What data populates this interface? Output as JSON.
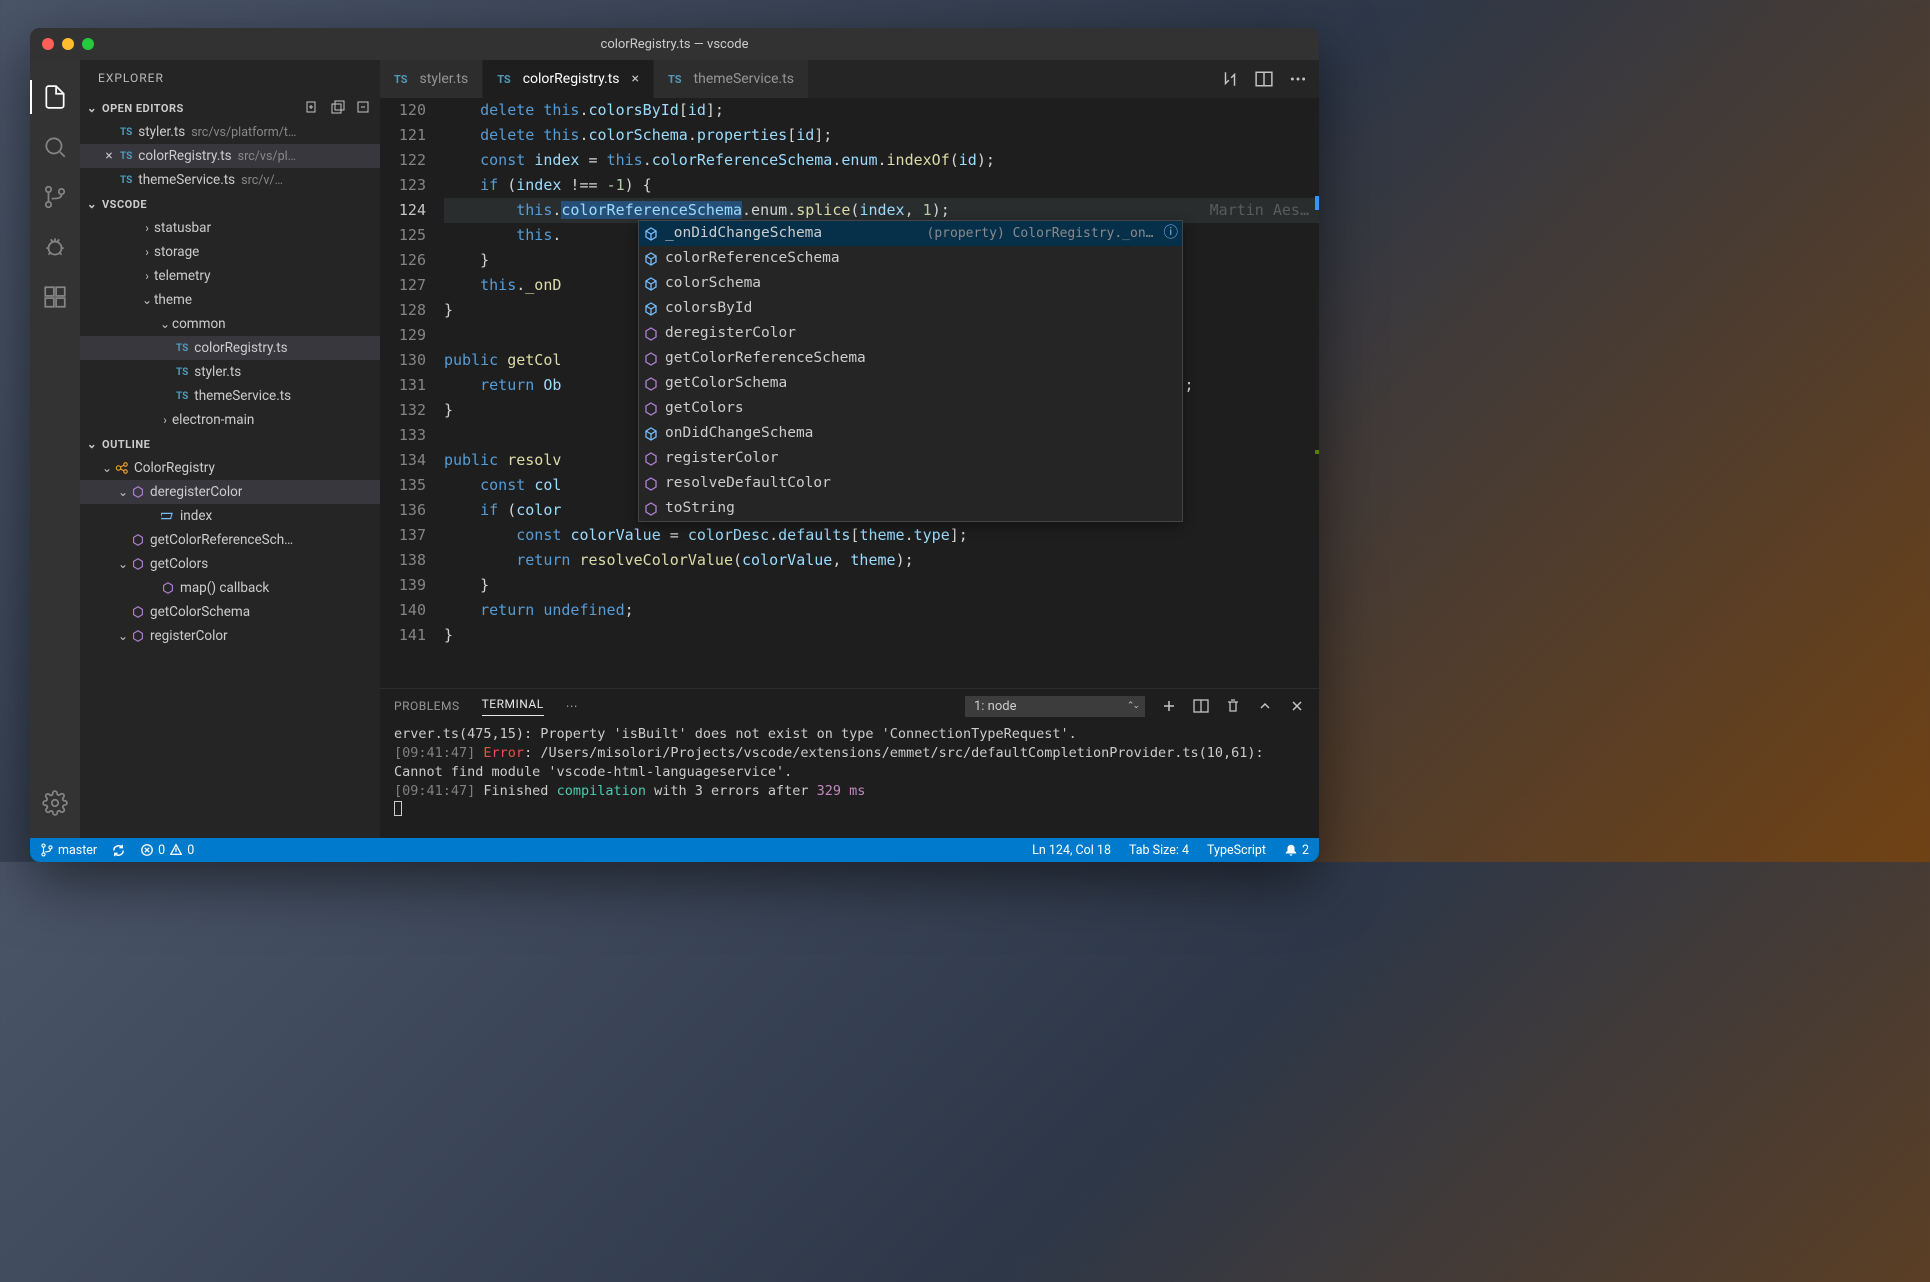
{
  "title": "colorRegistry.ts — vscode",
  "sidebar_title": "EXPLORER",
  "sections": {
    "open_editors": "OPEN EDITORS",
    "workspace": "VSCODE",
    "outline": "OUTLINE"
  },
  "open_editors": [
    {
      "name": "styler.ts",
      "desc": "src/vs/platform/t…"
    },
    {
      "name": "colorRegistry.ts",
      "desc": "src/vs/pl…",
      "active": true
    },
    {
      "name": "themeService.ts",
      "desc": "src/v/…"
    }
  ],
  "tree": [
    {
      "indent": 60,
      "chev": "›",
      "label": "statusbar"
    },
    {
      "indent": 60,
      "chev": "›",
      "label": "storage"
    },
    {
      "indent": 60,
      "chev": "›",
      "label": "telemetry"
    },
    {
      "indent": 60,
      "chev": "⌄",
      "label": "theme"
    },
    {
      "indent": 78,
      "chev": "⌄",
      "label": "common"
    },
    {
      "indent": 96,
      "icon": "ts",
      "label": "colorRegistry.ts",
      "selected": true
    },
    {
      "indent": 96,
      "icon": "ts",
      "label": "styler.ts"
    },
    {
      "indent": 96,
      "icon": "ts",
      "label": "themeService.ts"
    },
    {
      "indent": 78,
      "chev": "›",
      "label": "electron-main"
    }
  ],
  "outline": [
    {
      "indent": 20,
      "chev": "⌄",
      "icon": "class",
      "label": "ColorRegistry"
    },
    {
      "indent": 36,
      "chev": "⌄",
      "icon": "method",
      "label": "deregisterColor",
      "selected": true
    },
    {
      "indent": 66,
      "icon": "var",
      "label": "index"
    },
    {
      "indent": 36,
      "chev": "",
      "icon": "method",
      "label": "getColorReferenceSch…"
    },
    {
      "indent": 36,
      "chev": "⌄",
      "icon": "method",
      "label": "getColors"
    },
    {
      "indent": 66,
      "icon": "method",
      "label": "map() callback"
    },
    {
      "indent": 36,
      "chev": "",
      "icon": "method",
      "label": "getColorSchema"
    },
    {
      "indent": 36,
      "chev": "⌄",
      "icon": "method",
      "label": "registerColor"
    }
  ],
  "tabs": [
    {
      "name": "styler.ts"
    },
    {
      "name": "colorRegistry.ts",
      "active": true,
      "close": true
    },
    {
      "name": "themeService.ts"
    }
  ],
  "blame": "Martin Aes…",
  "line_start": 120,
  "code": [
    "    delete this.colorsById[id];",
    "    delete this.colorSchema.properties[id];",
    "    const index = this.colorReferenceSchema.enum.indexOf(id);",
    "    if (index !== -1) {",
    "        this.colorReferenceSchema.enum.splice(index, 1);",
    "        this.",
    "    }",
    "    this._onD",
    "}",
    "",
    "public getCol",
    "    return Ob                                                                    );",
    "}",
    "",
    "public resolv                                                               | un",
    "    const col",
    "    if (color",
    "        const colorValue = colorDesc.defaults[theme.type];",
    "        return resolveColorValue(colorValue, theme);",
    "    }",
    "    return undefined;",
    "}"
  ],
  "suggest": [
    {
      "icon": "prop",
      "label": "_onDidChangeSchema",
      "detail": "(property) ColorRegistry._on…",
      "info": true,
      "selected": true
    },
    {
      "icon": "prop",
      "label": "colorReferenceSchema"
    },
    {
      "icon": "prop",
      "label": "colorSchema"
    },
    {
      "icon": "prop",
      "label": "colorsById"
    },
    {
      "icon": "method",
      "label": "deregisterColor"
    },
    {
      "icon": "method",
      "label": "getColorReferenceSchema"
    },
    {
      "icon": "method",
      "label": "getColorSchema"
    },
    {
      "icon": "method",
      "label": "getColors"
    },
    {
      "icon": "prop",
      "label": "onDidChangeSchema"
    },
    {
      "icon": "method",
      "label": "registerColor"
    },
    {
      "icon": "method",
      "label": "resolveDefaultColor"
    },
    {
      "icon": "method",
      "label": "toString"
    }
  ],
  "panel": {
    "tabs": {
      "problems": "PROBLEMS",
      "terminal": "TERMINAL"
    },
    "select": "1: node",
    "lines": [
      "erver.ts(475,15): Property 'isBuilt' does not exist on type 'ConnectionTypeRequest'.",
      "[09:41:47] Error: /Users/misolori/Projects/vscode/extensions/emmet/src/defaultCompletionProvider.ts(10,61): Cannot find module 'vscode-html-languageservice'.",
      "[09:41:47] Finished compilation with 3 errors after 329 ms"
    ]
  },
  "status": {
    "branch": "master",
    "errors": "0",
    "warnings": "0",
    "lncol": "Ln 124, Col 18",
    "tabsize": "Tab Size: 4",
    "lang": "TypeScript",
    "notif": "2"
  }
}
